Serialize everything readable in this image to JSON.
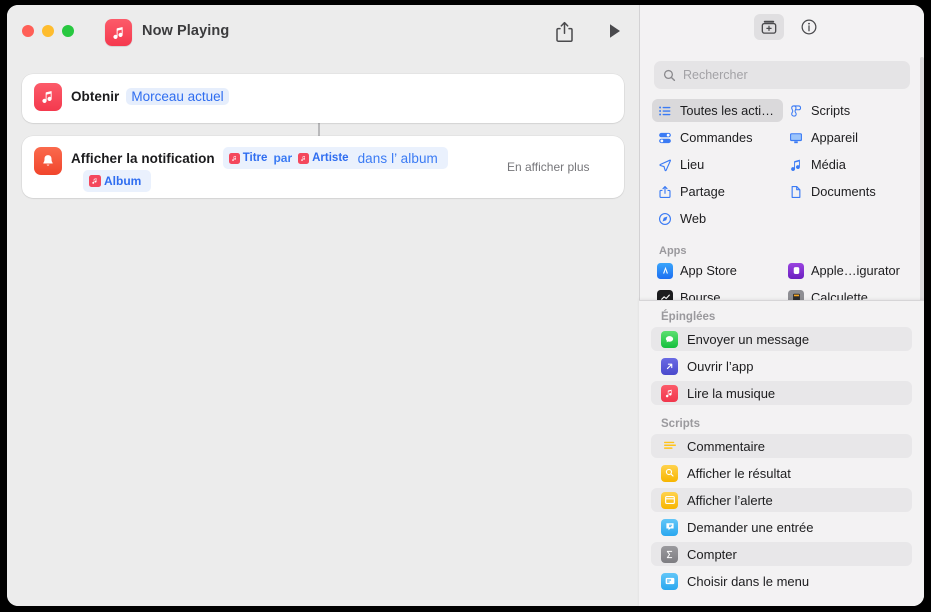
{
  "window": {
    "title": "Now Playing",
    "traffic_lights": [
      "close",
      "minimize",
      "zoom"
    ],
    "app_icon": "music-app-icon",
    "share_button": "share-icon",
    "play_button": "play-icon"
  },
  "workflow": {
    "actions": [
      {
        "icon": "music-app-icon",
        "label": "Obtenir",
        "field": "Morceau actuel"
      },
      {
        "icon": "notification-bell-icon",
        "label": "Afficher la notification",
        "tokens_line1": [
          {
            "type": "variable",
            "text": "Titre",
            "glyph": "music-note-icon"
          },
          {
            "type": "text",
            "text": "par"
          },
          {
            "type": "variable",
            "text": "Artiste",
            "glyph": "music-note-icon"
          },
          {
            "type": "text_big",
            "text": "dans l’ album"
          }
        ],
        "tokens_line2": [
          {
            "type": "variable",
            "text": "Album",
            "glyph": "music-note-icon"
          }
        ],
        "show_more": "En afficher plus"
      }
    ]
  },
  "sidebar": {
    "toolbar": {
      "library_button": "action-library-icon",
      "info_button": "info-circle-icon"
    },
    "search": {
      "placeholder": "Rechercher",
      "value": "",
      "icon": "search-icon"
    },
    "categories": [
      {
        "label": "Toutes les acti…",
        "icon": "list-bullet-icon",
        "selected": true
      },
      {
        "label": "Scripts",
        "icon": "scroll-icon",
        "selected": false
      },
      {
        "label": "Commandes",
        "icon": "sliders-icon",
        "selected": false
      },
      {
        "label": "Appareil",
        "icon": "display-icon",
        "selected": false
      },
      {
        "label": "Lieu",
        "icon": "location-arrow-icon",
        "selected": false
      },
      {
        "label": "Média",
        "icon": "music-note-icon",
        "selected": false
      },
      {
        "label": "Partage",
        "icon": "share-icon",
        "selected": false
      },
      {
        "label": "Documents",
        "icon": "document-icon",
        "selected": false
      },
      {
        "label": "Web",
        "icon": "safari-compass-icon",
        "selected": false
      }
    ],
    "apps_section": {
      "title": "Apps",
      "items": [
        {
          "label": "App Store",
          "icon": "app-store-icon",
          "color": "#2f8cf5"
        },
        {
          "label": "Apple…igurator",
          "icon": "apple-configurator-icon",
          "color": "#7c2ecf"
        },
        {
          "label": "Bourse",
          "icon": "stocks-icon",
          "color": "#1c1c1e"
        },
        {
          "label": "Calculette",
          "icon": "calculator-icon",
          "color": "#8e8e93"
        }
      ]
    }
  },
  "overlay": {
    "pinned_section": {
      "title": "Épinglées",
      "items": [
        {
          "label": "Envoyer un message",
          "icon": "messages-icon",
          "color": "#32c759",
          "alt": true
        },
        {
          "label": "Ouvrir l’app",
          "icon": "open-app-icon",
          "color": "#5b5bd6",
          "alt": false
        },
        {
          "label": "Lire la musique",
          "icon": "music-app-icon",
          "color": "#f4485d",
          "alt": true
        }
      ]
    },
    "scripts_section": {
      "title": "Scripts",
      "items": [
        {
          "label": "Commentaire",
          "icon": "comment-lines-icon",
          "color": "#f3f2f3",
          "alt": true
        },
        {
          "label": "Afficher le résultat",
          "icon": "quicklook-icon",
          "color": "#ffc319",
          "alt": false
        },
        {
          "label": "Afficher l’alerte",
          "icon": "alert-window-icon",
          "color": "#ffc319",
          "alt": true
        },
        {
          "label": "Demander une entrée",
          "icon": "ask-input-icon",
          "color": "#45b5f5",
          "alt": false
        },
        {
          "label": "Compter",
          "icon": "sigma-count-icon",
          "color": "#8a898d",
          "alt": true
        },
        {
          "label": "Choisir dans le menu",
          "icon": "choose-menu-icon",
          "color": "#45b5f5",
          "alt": false
        }
      ]
    }
  },
  "colors": {
    "accent_blue": "#2f6df0",
    "window_bg": "#ececec",
    "sidebar_bg": "#f3f2f3",
    "selection": "#dad9db",
    "red_music": "#f4485d"
  }
}
